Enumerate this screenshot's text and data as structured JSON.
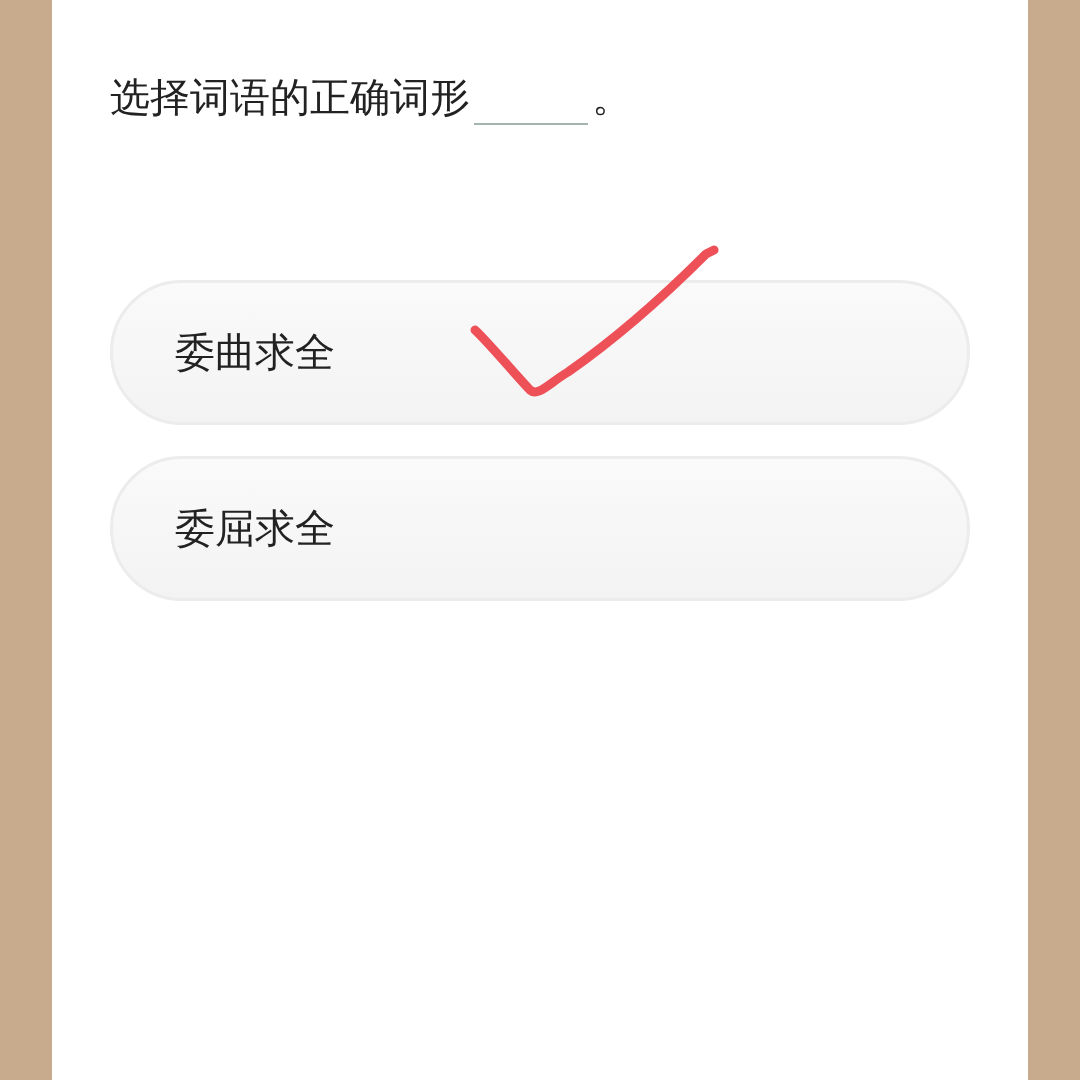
{
  "question": {
    "text": "选择词语的正确词形",
    "end": "。"
  },
  "options": [
    {
      "label": "委曲求全",
      "checked": true
    },
    {
      "label": "委屈求全",
      "checked": false
    }
  ]
}
